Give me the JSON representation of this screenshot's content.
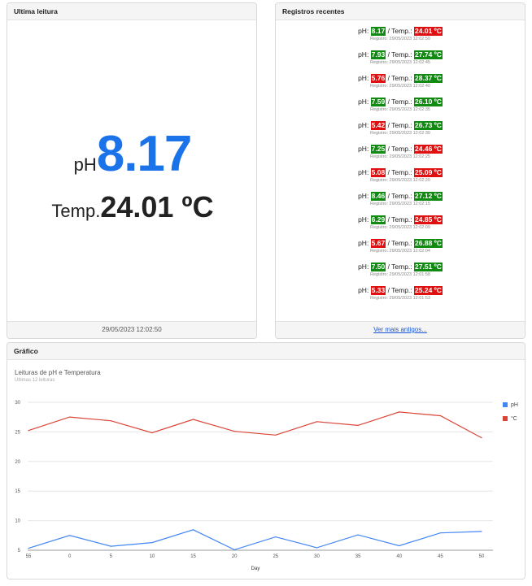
{
  "last_reading": {
    "header": "Ultima leitura",
    "ph_label": "pH",
    "ph_value": "8.17",
    "temp_label": "Temp.",
    "temp_value": "24.01 ºC",
    "timestamp": "29/05/2023 12:02:50"
  },
  "recent": {
    "header": "Registros recentes",
    "ph_prefix": "pH: ",
    "temp_prefix": " / Temp.: ",
    "time_prefix": "Registro: ",
    "footer_link": "Ver mais antigos...",
    "records": [
      {
        "ph": "8.17",
        "ph_ok": true,
        "temp": "24.01 ºC",
        "temp_ok": false,
        "time": "29/05/2023 12:02:50"
      },
      {
        "ph": "7.93",
        "ph_ok": true,
        "temp": "27.74 ºC",
        "temp_ok": true,
        "time": "29/05/2023 12:02:45"
      },
      {
        "ph": "5.76",
        "ph_ok": false,
        "temp": "28.37 ºC",
        "temp_ok": true,
        "time": "29/05/2023 12:02:40"
      },
      {
        "ph": "7.59",
        "ph_ok": true,
        "temp": "26.10 ºC",
        "temp_ok": true,
        "time": "29/05/2023 12:02:35"
      },
      {
        "ph": "5.42",
        "ph_ok": false,
        "temp": "26.73 ºC",
        "temp_ok": true,
        "time": "29/05/2023 12:02:30"
      },
      {
        "ph": "7.25",
        "ph_ok": true,
        "temp": "24.46 ºC",
        "temp_ok": false,
        "time": "29/05/2023 12:02:25"
      },
      {
        "ph": "5.08",
        "ph_ok": false,
        "temp": "25.09 ºC",
        "temp_ok": false,
        "time": "29/05/2023 12:02:20"
      },
      {
        "ph": "8.46",
        "ph_ok": true,
        "temp": "27.12 ºC",
        "temp_ok": true,
        "time": "29/05/2023 12:02:15"
      },
      {
        "ph": "6.29",
        "ph_ok": true,
        "temp": "24.85 ºC",
        "temp_ok": false,
        "time": "29/05/2023 12:02:09"
      },
      {
        "ph": "5.67",
        "ph_ok": false,
        "temp": "26.88 ºC",
        "temp_ok": true,
        "time": "29/05/2023 12:02:04"
      },
      {
        "ph": "7.50",
        "ph_ok": true,
        "temp": "27.51 ºC",
        "temp_ok": true,
        "time": "29/05/2023 12:01:58"
      },
      {
        "ph": "5.33",
        "ph_ok": false,
        "temp": "25.24 ºC",
        "temp_ok": false,
        "time": "29/05/2023 12:01:53"
      }
    ],
    "colors": {
      "ok": "#118a11",
      "bad": "#e01010"
    }
  },
  "chart_card": {
    "header": "Gráfico"
  },
  "chart_data": {
    "type": "line",
    "title": "Leituras de pH e Temperatura",
    "subtitle": "Ultimas 12 leituras",
    "xlabel": "Day",
    "ylabel": "",
    "ylim": [
      5,
      30
    ],
    "yticks": [
      5,
      10,
      15,
      20,
      25,
      30
    ],
    "categories": [
      "55",
      "0",
      "5",
      "10",
      "15",
      "20",
      "25",
      "30",
      "35",
      "40",
      "45",
      "50"
    ],
    "xtick_labels": [
      "55",
      "0",
      "5",
      "10",
      "15",
      "20",
      "25",
      "30",
      "35",
      "40",
      "45",
      "50"
    ],
    "grid": true,
    "legend_position": "right",
    "series": [
      {
        "name": "pH",
        "color": "#4285f4",
        "values": [
          5.33,
          7.5,
          5.67,
          6.29,
          8.46,
          5.08,
          7.25,
          5.42,
          7.59,
          5.76,
          7.93,
          8.17
        ]
      },
      {
        "name": "°C",
        "color": "#db4437",
        "values": [
          25.24,
          27.51,
          26.88,
          24.85,
          27.12,
          25.09,
          24.46,
          26.73,
          26.1,
          28.37,
          27.74,
          24.01
        ]
      }
    ]
  }
}
